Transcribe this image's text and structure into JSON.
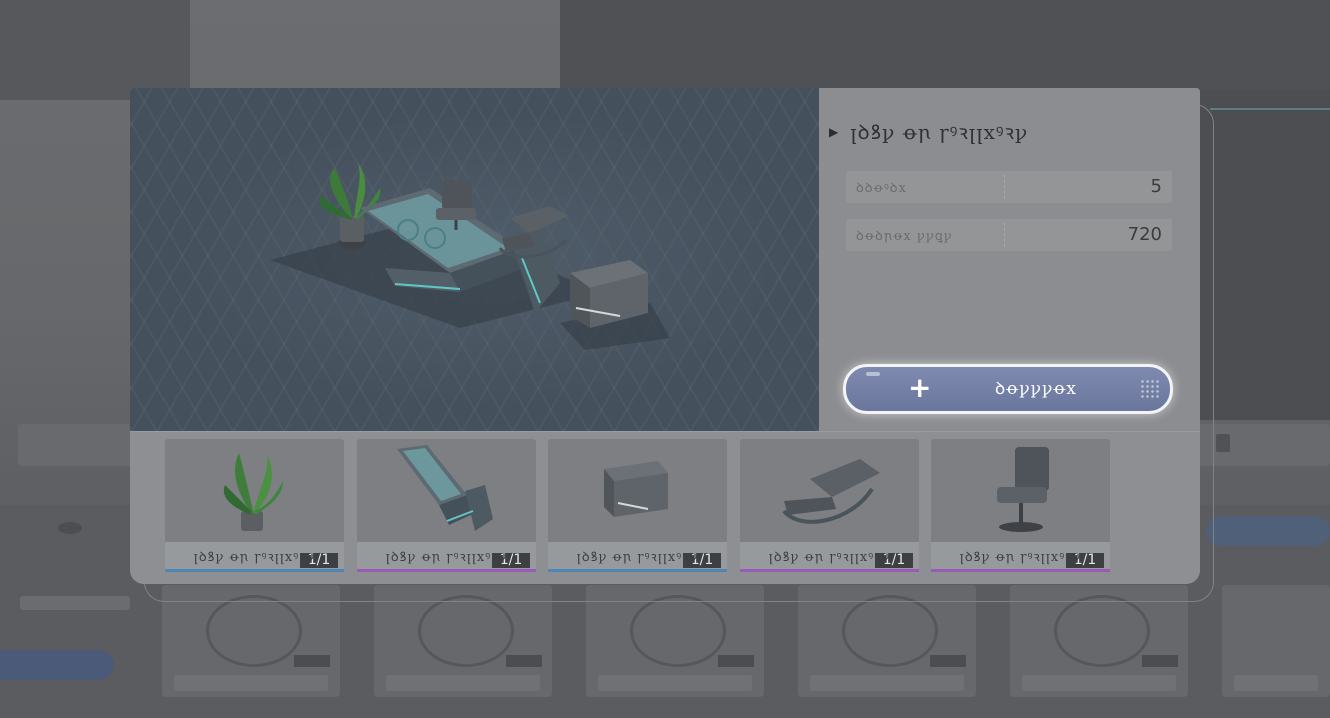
{
  "product": {
    "title": "ꞁꝺꝸꝩ ꝋꞃ ꞅꝰꝛꞁꞁxꝰꝛꝩ"
  },
  "stats": [
    {
      "label": "ꝺꝺꝋꝰꝺx",
      "value": "5"
    },
    {
      "label": "ꝺꝋꝺꞃꝋx ꝩꝩꝗꝩ",
      "value": "720"
    }
  ],
  "add_button": {
    "label": "ꝺꝋꝩꝩꝩꝋx"
  },
  "items": [
    {
      "name": "ꞁꝺꝸꝩ ꝋꞃ ꞅꝰꝛꞁꞁxꝰꝛꝩ",
      "count": "1/1",
      "rarity_color": "#4f86b8",
      "icon": "plant-icon"
    },
    {
      "name": "ꞁꝺꝸꝩ ꝋꞃ ꞅꝰꝛꞁꞁxꝰꝛꝩ",
      "count": "1/1",
      "rarity_color": "#9a5ab8",
      "icon": "desk-icon"
    },
    {
      "name": "ꞁꝺꝸꝩ ꝋꞃ ꞅꝰꝛꞁꞁxꝰꝛꝩ",
      "count": "1/1",
      "rarity_color": "#4f86b8",
      "icon": "cabinet-icon"
    },
    {
      "name": "ꞁꝺꝸꝩ ꝋꞃ ꞅꝰꝛꞁꞁxꝰꝛꝩ",
      "count": "1/1",
      "rarity_color": "#9a5ab8",
      "icon": "lounge-chair-icon"
    },
    {
      "name": "ꞁꝺꝸꝩ ꝋꞃ ꞅꝰꝛꞁꞁxꝰꝛꝩ",
      "count": "1/1",
      "rarity_color": "#9a5ab8",
      "icon": "office-chair-icon"
    }
  ]
}
